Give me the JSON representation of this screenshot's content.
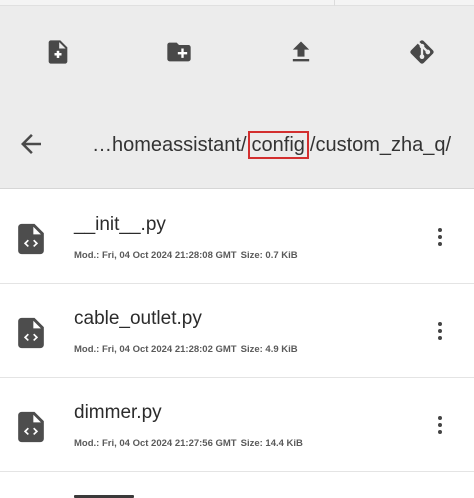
{
  "toolbar": {
    "buttons": [
      {
        "name": "new-file-button",
        "icon": "file-plus-icon"
      },
      {
        "name": "new-folder-button",
        "icon": "folder-plus-icon"
      },
      {
        "name": "upload-button",
        "icon": "upload-icon"
      },
      {
        "name": "git-button",
        "icon": "git-icon"
      }
    ]
  },
  "pathbar": {
    "back_icon": "arrow-left-icon",
    "prefix": "…homeassistant",
    "sep1": "/",
    "current": "config",
    "sep2": "/",
    "suffix": "custom_zha_q/",
    "highlight_color": "#d32f2f"
  },
  "files": [
    {
      "name": "__init__.py",
      "modified": "Mod.: Fri, 04 Oct 2024 21:28:08 GMT",
      "size": "Size: 0.7 KiB",
      "icon": "code-file-icon"
    },
    {
      "name": "cable_outlet.py",
      "modified": "Mod.: Fri, 04 Oct 2024 21:28:02 GMT",
      "size": "Size: 4.9 KiB",
      "icon": "code-file-icon"
    },
    {
      "name": "dimmer.py",
      "modified": "Mod.: Fri, 04 Oct 2024 21:27:56 GMT",
      "size": "Size: 14.4 KiB",
      "icon": "code-file-icon"
    }
  ],
  "colors": {
    "header_bg": "#ececec",
    "icon_color": "#494949"
  }
}
